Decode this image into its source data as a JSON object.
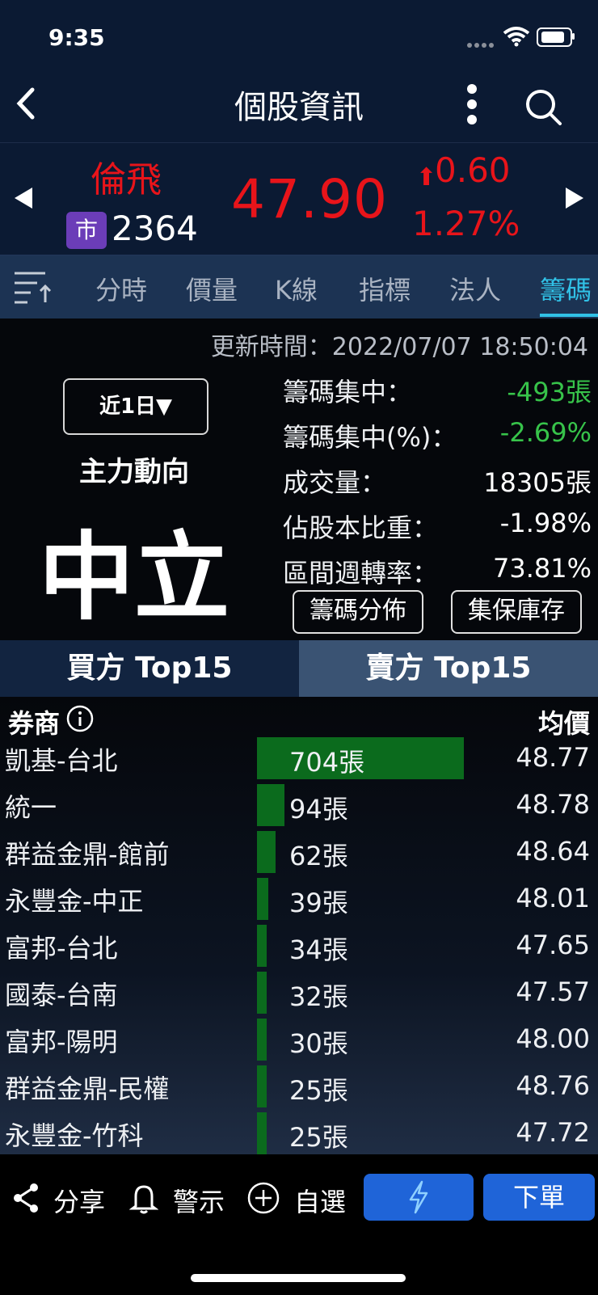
{
  "status": {
    "time": "9:35"
  },
  "header": {
    "title": "個股資訊"
  },
  "stock": {
    "name": "倫飛",
    "market_badge": "市",
    "code": "2364",
    "price": "47.90",
    "change_arrow": "⬆",
    "change": "0.60",
    "change_pct": "1.27%",
    "up_color": "#e8141a"
  },
  "tabs": [
    "分時",
    "價量",
    "K線",
    "指標",
    "法人",
    "籌碼"
  ],
  "active_tab": "籌碼",
  "chip": {
    "update_time": "更新時間：2022/07/07 18:50:04",
    "period": "近1日▼",
    "main_force_label": "主力動向",
    "main_force_value": "中立",
    "rows": [
      {
        "label": "籌碼集中：",
        "value": "-493張"
      },
      {
        "label": "籌碼集中(%)：",
        "value": "-2.69%"
      },
      {
        "label": "成交量：",
        "value": "18305張"
      },
      {
        "label": "佔股本比重：",
        "value": "-1.98%"
      },
      {
        "label": "區間週轉率：",
        "value": "73.81%"
      }
    ],
    "distribution_button": "籌碼分佈",
    "custody_button": "集保庫存"
  },
  "side_tabs": {
    "buy": "買方 Top15",
    "sell": "賣方 Top15"
  },
  "list_header": {
    "broker": "券商",
    "avg": "均價"
  },
  "brokers": [
    {
      "name": "凱基-台北",
      "qty": 704,
      "qty_label": "704張",
      "avg": "48.77"
    },
    {
      "name": "統一",
      "qty": 94,
      "qty_label": "94張",
      "avg": "48.78"
    },
    {
      "name": "群益金鼎-館前",
      "qty": 62,
      "qty_label": "62張",
      "avg": "48.64"
    },
    {
      "name": "永豐金-中正",
      "qty": 39,
      "qty_label": "39張",
      "avg": "48.01"
    },
    {
      "name": "富邦-台北",
      "qty": 34,
      "qty_label": "34張",
      "avg": "47.65"
    },
    {
      "name": "國泰-台南",
      "qty": 32,
      "qty_label": "32張",
      "avg": "47.57"
    },
    {
      "name": "富邦-陽明",
      "qty": 30,
      "qty_label": "30張",
      "avg": "48.00"
    },
    {
      "name": "群益金鼎-民權",
      "qty": 25,
      "qty_label": "25張",
      "avg": "48.76"
    },
    {
      "name": "永豐金-竹科",
      "qty": 25,
      "qty_label": "25張",
      "avg": "47.72"
    }
  ],
  "toolbar": {
    "share": "分享",
    "alert": "警示",
    "watchlist": "自選",
    "order": "下單"
  }
}
